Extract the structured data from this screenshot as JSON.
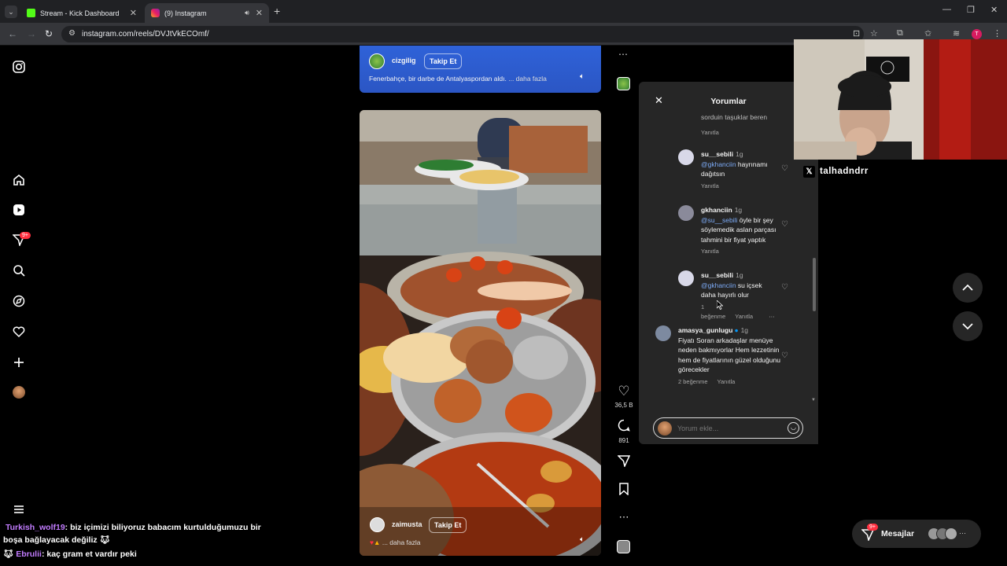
{
  "browser": {
    "tabs": [
      {
        "title": "Stream - Kick Dashboard"
      },
      {
        "title": "(9) Instagram"
      }
    ],
    "url": "instagram.com/reels/DVJtVkECOmf/"
  },
  "sidebar": {
    "badge": "9+",
    "icons": [
      "instagram-logo-icon",
      "home-icon",
      "reels-icon",
      "messages-icon",
      "search-icon",
      "explore-icon",
      "heart-icon",
      "create-icon",
      "profile-avatar",
      "menu-icon"
    ]
  },
  "top_reel": {
    "user": "cizgilig",
    "follow": "Takip Et",
    "caption": "Fenerbahçe, bir darbe de Antalyaspordan aldı.",
    "more": "... daha fazla"
  },
  "main_reel": {
    "user": "zaimusta",
    "follow": "Takip Et",
    "more": "... daha fazla",
    "likes": "36,5 B",
    "comments_count": "891"
  },
  "comments_panel": {
    "title": "Yorumlar",
    "partial_text": "sorduin taşuklar beren",
    "reply_label": "Yanıtla",
    "items": [
      {
        "user": "su__sebili",
        "time": "1g",
        "mention": "@gkhanciin",
        "text": " hayrınamı dağıtsın",
        "likes": ""
      },
      {
        "user": "gkhanciin",
        "time": "1g",
        "mention": "@su__sebili",
        "text": " öyle bir şey söylemedik aslan parçası tahmini bir fiyat yaptık",
        "likes": ""
      },
      {
        "user": "su__sebili",
        "time": "1g",
        "mention": "@gkhanciin",
        "text": " su içsek daha hayırlı olur",
        "likes": "1 beğenme"
      },
      {
        "user": "amasya_gunlugu",
        "time": "1g",
        "mention": "",
        "text": "Fiyatı Soran arkadaşlar menüye neden bakmıyorlar Hem lezzetinin hem de fiyatlarının güzel olduğunu görecekler",
        "likes": "2 beğenme"
      }
    ],
    "input_placeholder": "Yorum ekle..."
  },
  "stream_overlay": {
    "handle": "talhadndrr",
    "chat": [
      {
        "user": "Turkish_wolf19",
        "user_color": "#c27cff",
        "text": ": biz içimizi biliyoruz babacım kurtulduğumuzu bir boşa bağlayacak değiliz"
      },
      {
        "user": "Ebrulii",
        "user_color": "#c27cff",
        "text": ": kaç gram et vardır peki"
      }
    ]
  },
  "messages": {
    "label": "Mesajlar",
    "badge": "9+"
  },
  "colors": {
    "accent": "#0095f6",
    "chrome_bg": "#202124",
    "panel_bg": "#262626"
  }
}
